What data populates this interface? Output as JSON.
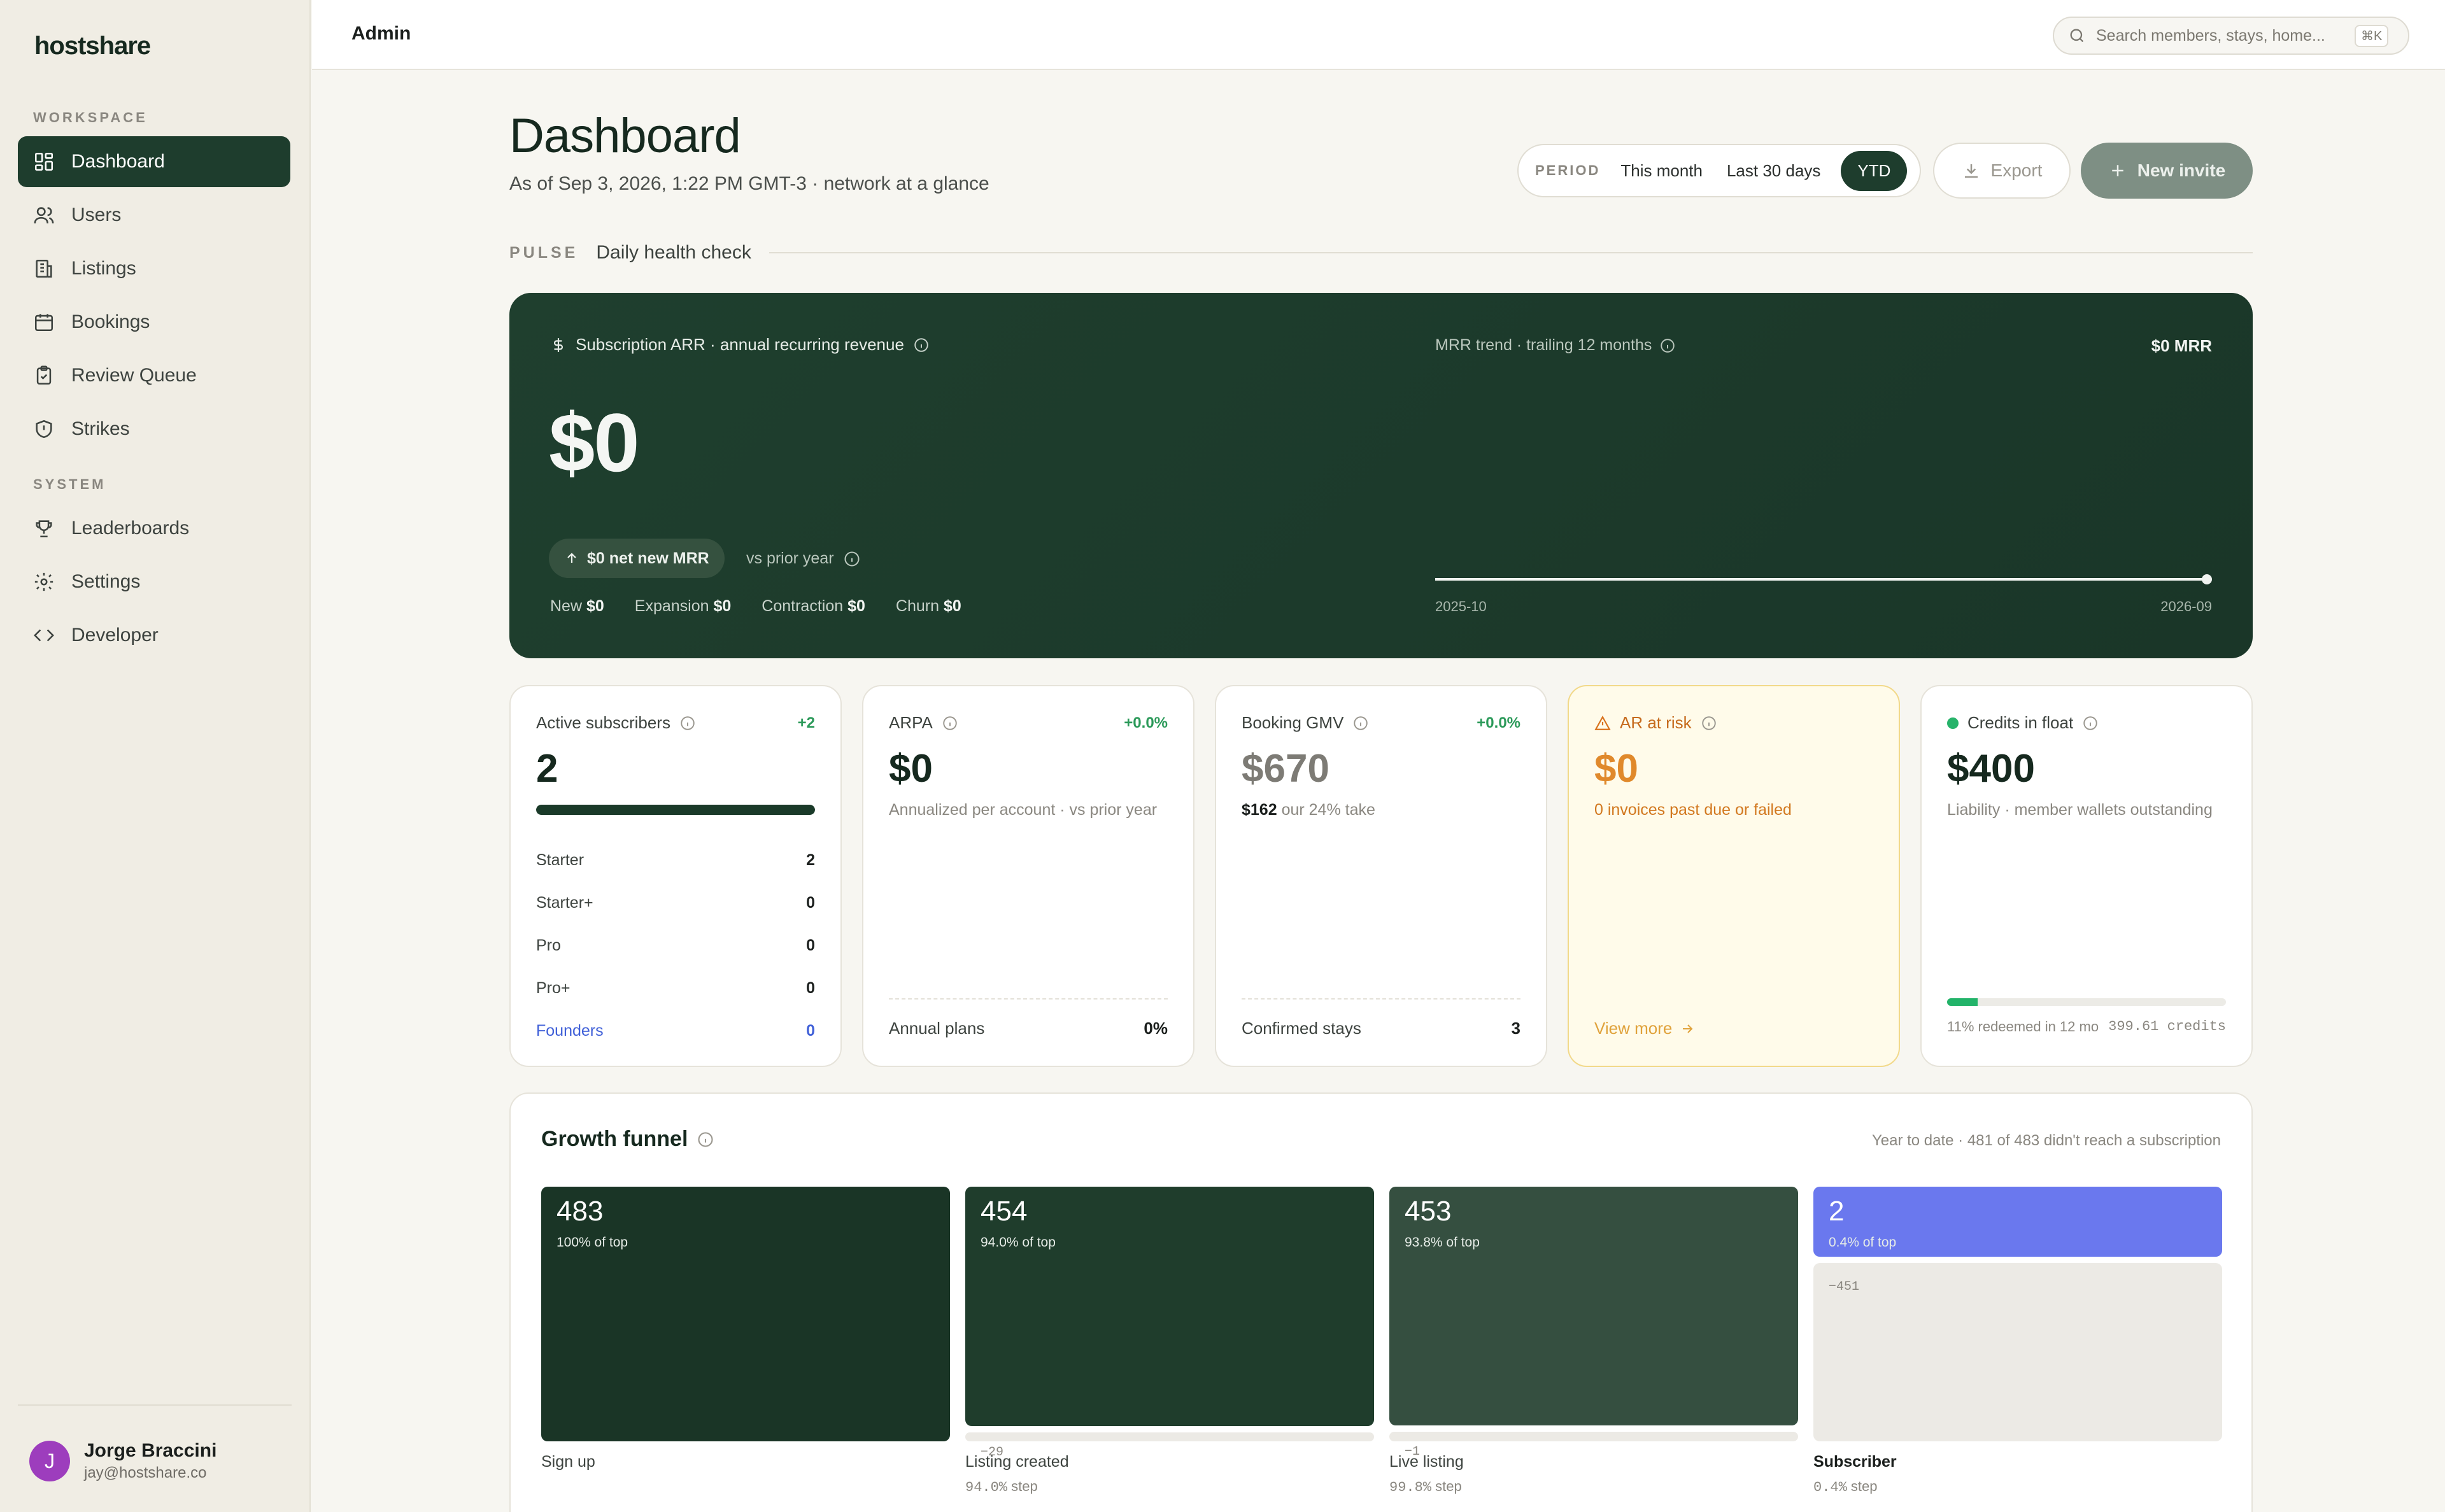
{
  "sidebar": {
    "brand": "hostshare",
    "workspace_label": "WORKSPACE",
    "system_label": "SYSTEM",
    "workspace_items": [
      {
        "label": "Dashboard",
        "icon": "grid-icon"
      },
      {
        "label": "Users",
        "icon": "users-icon"
      },
      {
        "label": "Listings",
        "icon": "building-icon"
      },
      {
        "label": "Bookings",
        "icon": "calendar-icon"
      },
      {
        "label": "Review Queue",
        "icon": "clipboard-check-icon"
      },
      {
        "label": "Strikes",
        "icon": "shield-icon"
      }
    ],
    "system_items": [
      {
        "label": "Leaderboards",
        "icon": "trophy-icon"
      },
      {
        "label": "Settings",
        "icon": "gear-icon"
      },
      {
        "label": "Developer",
        "icon": "code-icon"
      }
    ],
    "user": {
      "initial": "J",
      "name": "Jorge Braccini",
      "email": "jay@hostshare.co"
    }
  },
  "topbar": {
    "title": "Admin",
    "search_placeholder": "Search members, stays, home...",
    "shortcut": "⌘K"
  },
  "header": {
    "title": "Dashboard",
    "subtitle": "As of Sep 3, 2026, 1:22 PM GMT-3 · network at a glance",
    "period_label": "PERIOD",
    "period_options": [
      "This month",
      "Last 30 days",
      "YTD"
    ],
    "period_selected": "YTD",
    "export_label": "Export",
    "invite_label": "New invite"
  },
  "pulse": {
    "tag": "PULSE",
    "text": "Daily health check"
  },
  "arr": {
    "label": "Subscription ARR · annual recurring revenue",
    "value": "$0",
    "pill": "$0 net new MRR",
    "vs": "vs prior year",
    "breakdown": [
      {
        "label": "New",
        "value": "$0"
      },
      {
        "label": "Expansion",
        "value": "$0"
      },
      {
        "label": "Contraction",
        "value": "$0"
      },
      {
        "label": "Churn",
        "value": "$0"
      }
    ],
    "trend_label": "MRR trend · trailing 12 months",
    "trend_value": "$0 MRR",
    "trend_start": "2025-10",
    "trend_end": "2026-09",
    "trend_points": [
      0,
      0,
      0,
      0,
      0,
      0,
      0,
      0,
      0,
      0,
      0,
      0
    ]
  },
  "kpis": {
    "subscribers": {
      "label": "Active subscribers",
      "delta": "+2",
      "value": "2",
      "fill": 1.0,
      "tiers": [
        {
          "name": "Starter",
          "count": "2"
        },
        {
          "name": "Starter+",
          "count": "0"
        },
        {
          "name": "Pro",
          "count": "0"
        },
        {
          "name": "Pro+",
          "count": "0"
        },
        {
          "name": "Founders",
          "count": "0"
        }
      ]
    },
    "arpa": {
      "label": "ARPA",
      "delta": "+0.0%",
      "value": "$0",
      "note": "Annualized per account · vs prior year",
      "foot_label": "Annual plans",
      "foot_value": "0%"
    },
    "gmv": {
      "label": "Booking GMV",
      "delta": "+0.0%",
      "value": "$670",
      "note_strong": "$162",
      "note": " our 24% take",
      "foot_label": "Confirmed stays",
      "foot_value": "3"
    },
    "ar": {
      "label": "AR at risk",
      "value": "$0",
      "note": "0 invoices past due or failed",
      "link": "View more"
    },
    "float": {
      "label": "Credits in float",
      "value": "$400",
      "note": "Liability · member wallets outstanding",
      "redeemed_fraction": 0.11,
      "redeemed": "11% redeemed in 12 mo",
      "credits": "399.61 credits"
    }
  },
  "funnel": {
    "title": "Growth funnel",
    "meta": "Year to date · 481 of 483 didn't reach a subscription",
    "stages": [
      {
        "value": "483",
        "fraction": 1.0,
        "pct": "100% of top",
        "name": "Sign up",
        "drop": "",
        "step": "",
        "color": "#1a3526"
      },
      {
        "value": "454",
        "fraction": 0.94,
        "pct": "94.0% of top",
        "name": "Listing created",
        "drop": "−29",
        "step": "94.0%",
        "color": "#1f3d2c"
      },
      {
        "value": "453",
        "fraction": 0.938,
        "pct": "93.8% of top",
        "name": "Live listing",
        "drop": "−1",
        "step": "99.8%",
        "color": "#354f40"
      },
      {
        "value": "2",
        "fraction": 0.004,
        "pct": "0.4% of top",
        "name": "Subscriber",
        "drop": "−451",
        "step": "0.4%",
        "color": "#6a78ee"
      }
    ],
    "step_suffix": "step"
  },
  "colors": {
    "accent": "#1e3d2d",
    "positive": "#2c9a5a",
    "warning": "#e0a23b",
    "link": "#4060d8"
  }
}
